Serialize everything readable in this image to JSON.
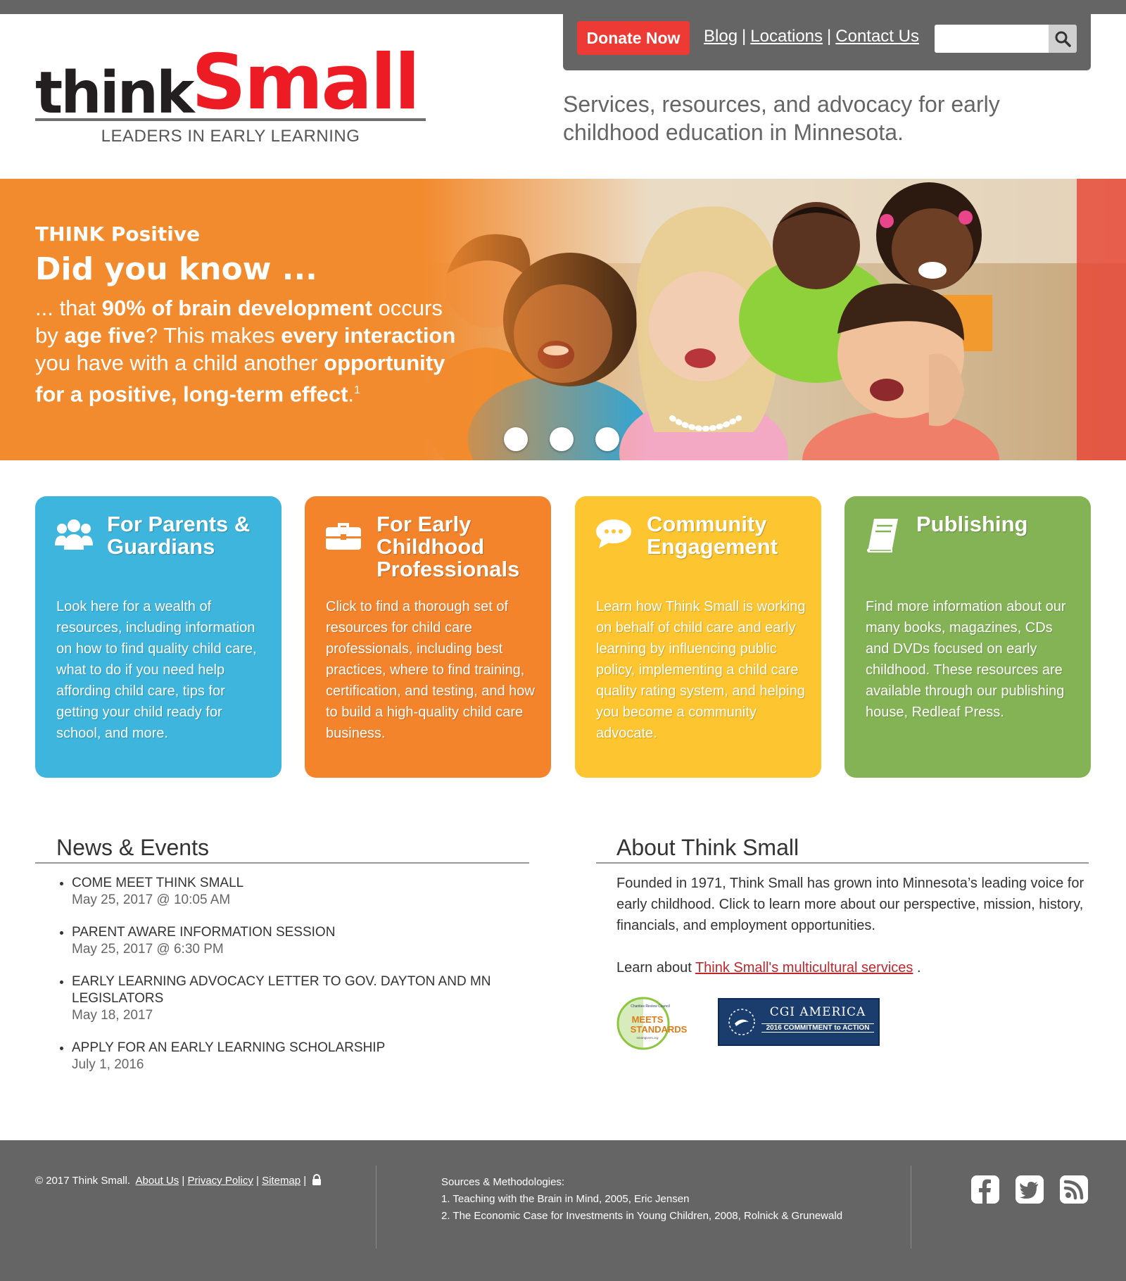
{
  "header": {
    "logo_think": "think",
    "logo_small": "Small",
    "logo_tagline": "LEADERS IN EARLY LEARNING",
    "donate_label": "Donate Now",
    "nav": [
      "Blog",
      "Locations",
      "Contact Us"
    ],
    "nav_separator": "|",
    "search_placeholder": "",
    "tagline": "Services, resources, and advocacy for early childhood education in Minnesota."
  },
  "hero": {
    "kicker": "THINK Positive",
    "title": "Did you know ...",
    "body_parts": [
      "... that ",
      "90% of brain development",
      " occurs by ",
      "age five",
      "?  This makes ",
      "every interaction",
      " you have with a child another ",
      "opportunity for a positive, long-term effect",
      ".",
      "1"
    ],
    "slides": 3
  },
  "cards": [
    {
      "title": "For Parents & Guardians",
      "icon": "users-icon",
      "color": "#3db5dc",
      "text": "Look here for a wealth of resources, including information on how to find quality child care, what to do if you need help affording child care, tips for getting your child ready for school, and more."
    },
    {
      "title": "For Early Childhood Professionals",
      "icon": "briefcase-icon",
      "color": "#f4842c",
      "text": "Click to find a thorough set of resources for child care professionals, including best practices, where to find training, certification, and testing, and how to build a high-quality child care business."
    },
    {
      "title": "Community Engagement",
      "icon": "chat-bubble-icon",
      "color": "#fdc52f",
      "text": "Learn how Think Small is working on behalf of child care and early learning by influencing public policy, implementing a child care quality rating system, and helping you become a community advocate."
    },
    {
      "title": "Publishing",
      "icon": "book-icon",
      "color": "#84b355",
      "text": "Find more information about our many books, magazines, CDs and DVDs focused on early childhood. These resources are available through our publishing house, Redleaf Press."
    }
  ],
  "news": {
    "title": "News & Events",
    "items": [
      {
        "title": "COME MEET THINK SMALL",
        "date": "May 25, 2017 @ 10:05 AM"
      },
      {
        "title": "PARENT AWARE INFORMATION SESSION",
        "date": "May 25, 2017 @ 6:30 PM"
      },
      {
        "title": "EARLY LEARNING ADVOCACY LETTER TO GOV. DAYTON AND MN LEGISLATORS",
        "date": "May 18, 2017"
      },
      {
        "title": "APPLY FOR AN EARLY LEARNING SCHOLARSHIP",
        "date": "July 1, 2016"
      }
    ]
  },
  "about": {
    "title": "About Think Small",
    "body": "Founded in 1971, Think Small has grown into Minnesota’s leading voice for early childhood. Click to learn more about our perspective, mission, history, financials, and employment opportunities.",
    "learn_prefix": "Learn about ",
    "learn_link": "Think Small's multicultural services",
    "learn_suffix": " .",
    "badge1_lines": [
      "Charities Review Council",
      "MEETS",
      "STANDARDS",
      "smartgivers.org"
    ],
    "badge2_title": "CGI AMERICA",
    "badge2_sub": "2016 COMMITMENT to ACTION"
  },
  "footer": {
    "copyright": "© 2017 Think Small.",
    "links": [
      "About Us",
      "Privacy Policy",
      "Sitemap"
    ],
    "separator": "|",
    "sources_title": "Sources & Methodologies:",
    "sources": [
      "1. Teaching with the Brain in Mind, 2005, Eric Jensen",
      "2. The Economic Case for Investments in Young Children, 2008, Rolnick & Grunewald"
    ],
    "social": [
      "facebook-icon",
      "twitter-icon",
      "rss-icon"
    ]
  }
}
